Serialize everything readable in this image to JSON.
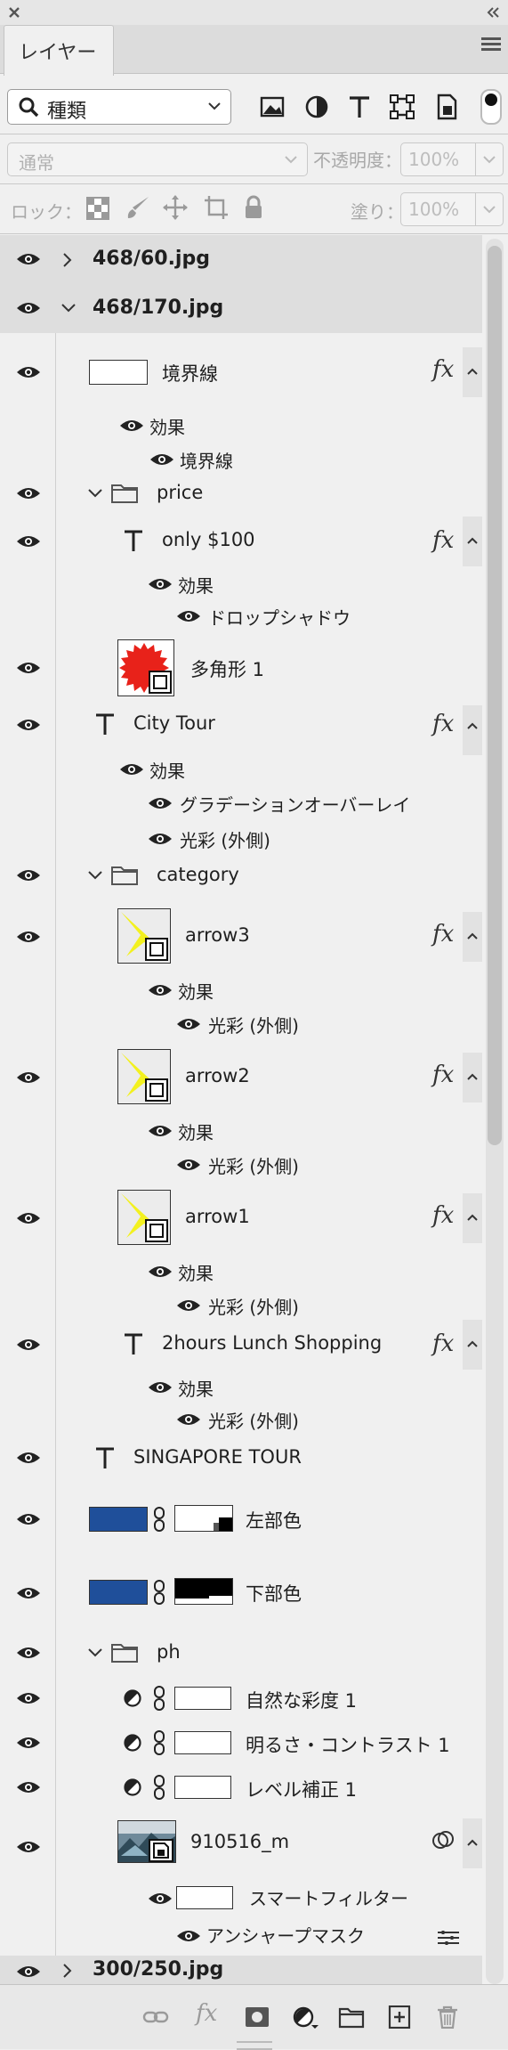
{
  "panel": {
    "tab_label": "レイヤー",
    "filter_label": "種類",
    "blend_mode": "通常",
    "opacity_label": "不透明度：",
    "opacity_value": "100%",
    "lock_label": "ロック：",
    "fill_label": "塗り：",
    "fill_value": "100%"
  },
  "layers": [
    {
      "label": "468/60.jpg"
    },
    {
      "label": "468/170.jpg"
    },
    {
      "label": "境界線",
      "effects_label": "効果",
      "effects": [
        "境界線"
      ]
    },
    {
      "label": "price"
    },
    {
      "label": "only $100",
      "effects_label": "効果",
      "effects": [
        "ドロップシャドウ"
      ]
    },
    {
      "label": "多角形 1"
    },
    {
      "label": "City Tour",
      "effects_label": "効果",
      "effects": [
        "グラデーションオーバーレイ",
        "光彩 (外側)"
      ]
    },
    {
      "label": "category"
    },
    {
      "label": "arrow3",
      "effects_label": "効果",
      "effects": [
        "光彩 (外側)"
      ]
    },
    {
      "label": "arrow2",
      "effects_label": "効果",
      "effects": [
        "光彩 (外側)"
      ]
    },
    {
      "label": "arrow1",
      "effects_label": "効果",
      "effects": [
        "光彩 (外側)"
      ]
    },
    {
      "label": "2hours Lunch Shopping",
      "effects_label": "効果",
      "effects": [
        "光彩 (外側)"
      ]
    },
    {
      "label": "SINGAPORE TOUR"
    },
    {
      "label": "左部色"
    },
    {
      "label": "下部色"
    },
    {
      "label": "ph"
    },
    {
      "label": "自然な彩度 1"
    },
    {
      "label": "明るさ・コントラスト 1"
    },
    {
      "label": "レベル補正 1"
    },
    {
      "label": "910516_m",
      "filters_label": "スマートフィルター",
      "filters": [
        "アンシャープマスク"
      ]
    },
    {
      "label": "300/250.jpg"
    }
  ],
  "fx_label": "fx",
  "colors": {
    "accent_blue": "#1f4f9a",
    "star_red": "#e8221a",
    "arrow_yellow": "#f3f11f"
  }
}
